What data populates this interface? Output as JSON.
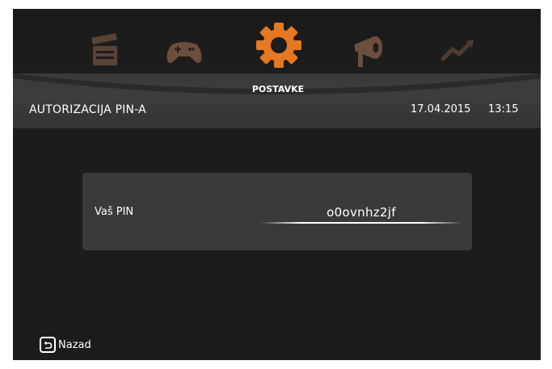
{
  "nav": {
    "items": [
      {
        "name": "clapperboard-icon",
        "color": "#5a4334"
      },
      {
        "name": "gamepad-icon",
        "color": "#6b4e3c"
      },
      {
        "name": "gear-icon",
        "color": "#e57822",
        "label": "POSTAVKE",
        "active": true
      },
      {
        "name": "megaphone-icon",
        "color": "#6b4e3c"
      },
      {
        "name": "trend-up-icon",
        "color": "#4f3c30"
      }
    ]
  },
  "header": {
    "title": "AUTORIZACIJA PIN-A",
    "date": "17.04.2015",
    "time": "13:15"
  },
  "pin": {
    "label": "Vaš PIN",
    "value": "o0ovnhz2jf"
  },
  "footer": {
    "back_label": "Nazad"
  },
  "colors": {
    "accent": "#e57822",
    "background": "#1c1c1c",
    "panel": "#3a3a3a"
  }
}
